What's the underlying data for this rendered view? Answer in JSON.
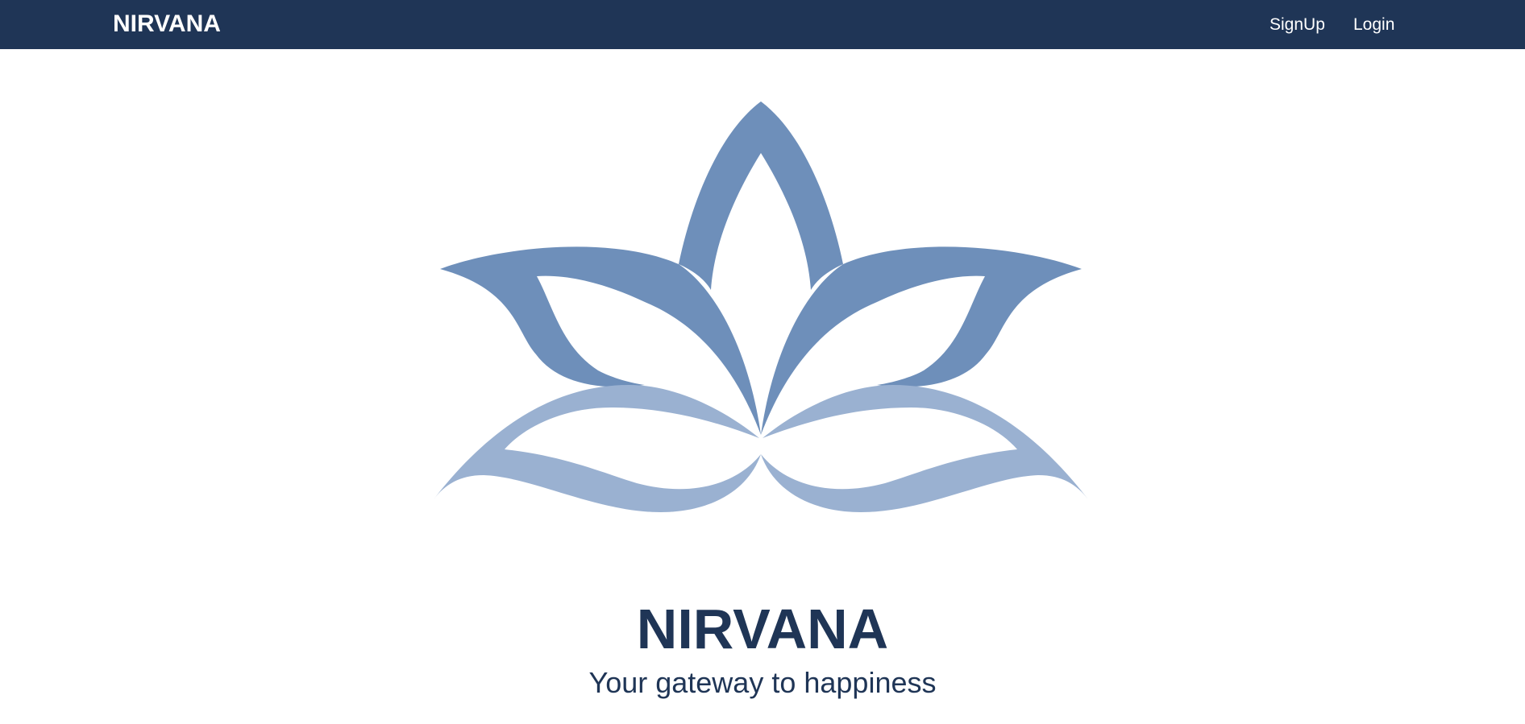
{
  "colors": {
    "navbar_bg": "#1f3556",
    "navbar_text": "#ffffff",
    "heading": "#1f3556",
    "lotus_dark": "#6e8fba",
    "lotus_light": "#9ab1d1"
  },
  "navbar": {
    "brand": "NIRVANA",
    "links": [
      {
        "label": "SignUp"
      },
      {
        "label": "Login"
      }
    ]
  },
  "hero": {
    "logo_icon": "lotus-flower-icon",
    "title": "NIRVANA",
    "tagline": "Your gateway to happiness"
  }
}
